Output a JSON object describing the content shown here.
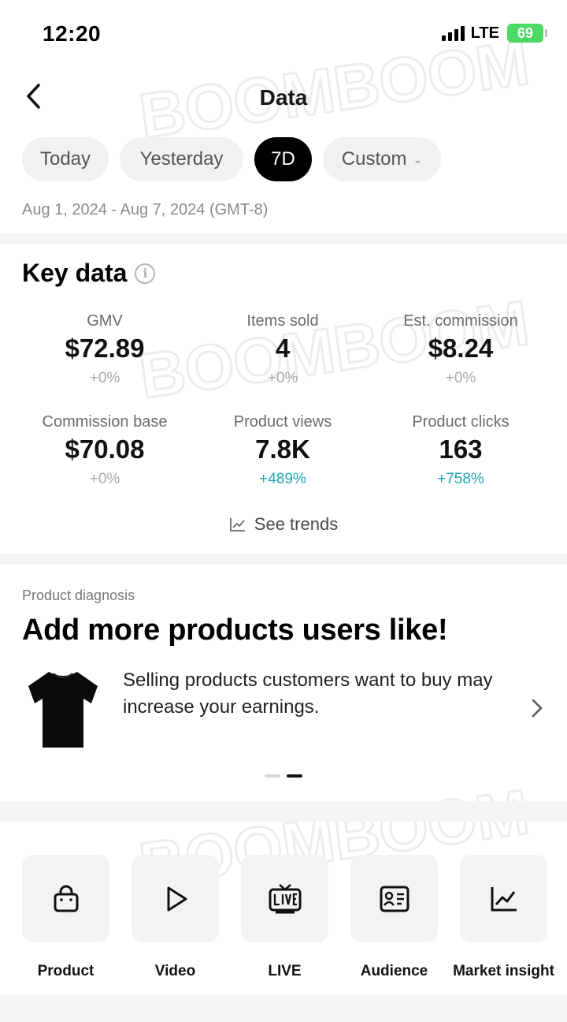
{
  "status_bar": {
    "time": "12:20",
    "network": "LTE",
    "battery": "69"
  },
  "header": {
    "title": "Data"
  },
  "period_tabs": [
    {
      "label": "Today",
      "active": false
    },
    {
      "label": "Yesterday",
      "active": false
    },
    {
      "label": "7D",
      "active": true
    },
    {
      "label": "Custom",
      "active": false
    }
  ],
  "date_range": "Aug 1, 2024 - Aug 7, 2024 (GMT-8)",
  "key_data": {
    "title": "Key data",
    "metrics": [
      {
        "label": "GMV",
        "value": "$72.89",
        "change": "+0%"
      },
      {
        "label": "Items sold",
        "value": "4",
        "change": "+0%"
      },
      {
        "label": "Est. commission",
        "value": "$8.24",
        "change": "+0%"
      },
      {
        "label": "Commission base",
        "value": "$70.08",
        "change": "+0%"
      },
      {
        "label": "Product views",
        "value": "7.8K",
        "change": "+489%"
      },
      {
        "label": "Product clicks",
        "value": "163",
        "change": "+758%"
      }
    ],
    "see_trends": "See trends"
  },
  "diagnosis": {
    "label": "Product diagnosis",
    "title": "Add more products users like!",
    "text": "Selling products customers want to buy may increase your earnings."
  },
  "tools": [
    {
      "label": "Product",
      "icon": "shopping-bag-icon"
    },
    {
      "label": "Video",
      "icon": "play-icon"
    },
    {
      "label": "LIVE",
      "icon": "live-tv-icon"
    },
    {
      "label": "Audience",
      "icon": "id-card-icon"
    },
    {
      "label": "Market insight",
      "icon": "line-chart-icon"
    }
  ],
  "colors": {
    "accent_positive": "#24a5bd",
    "active_tab": "#000000",
    "battery": "#4cd964"
  }
}
